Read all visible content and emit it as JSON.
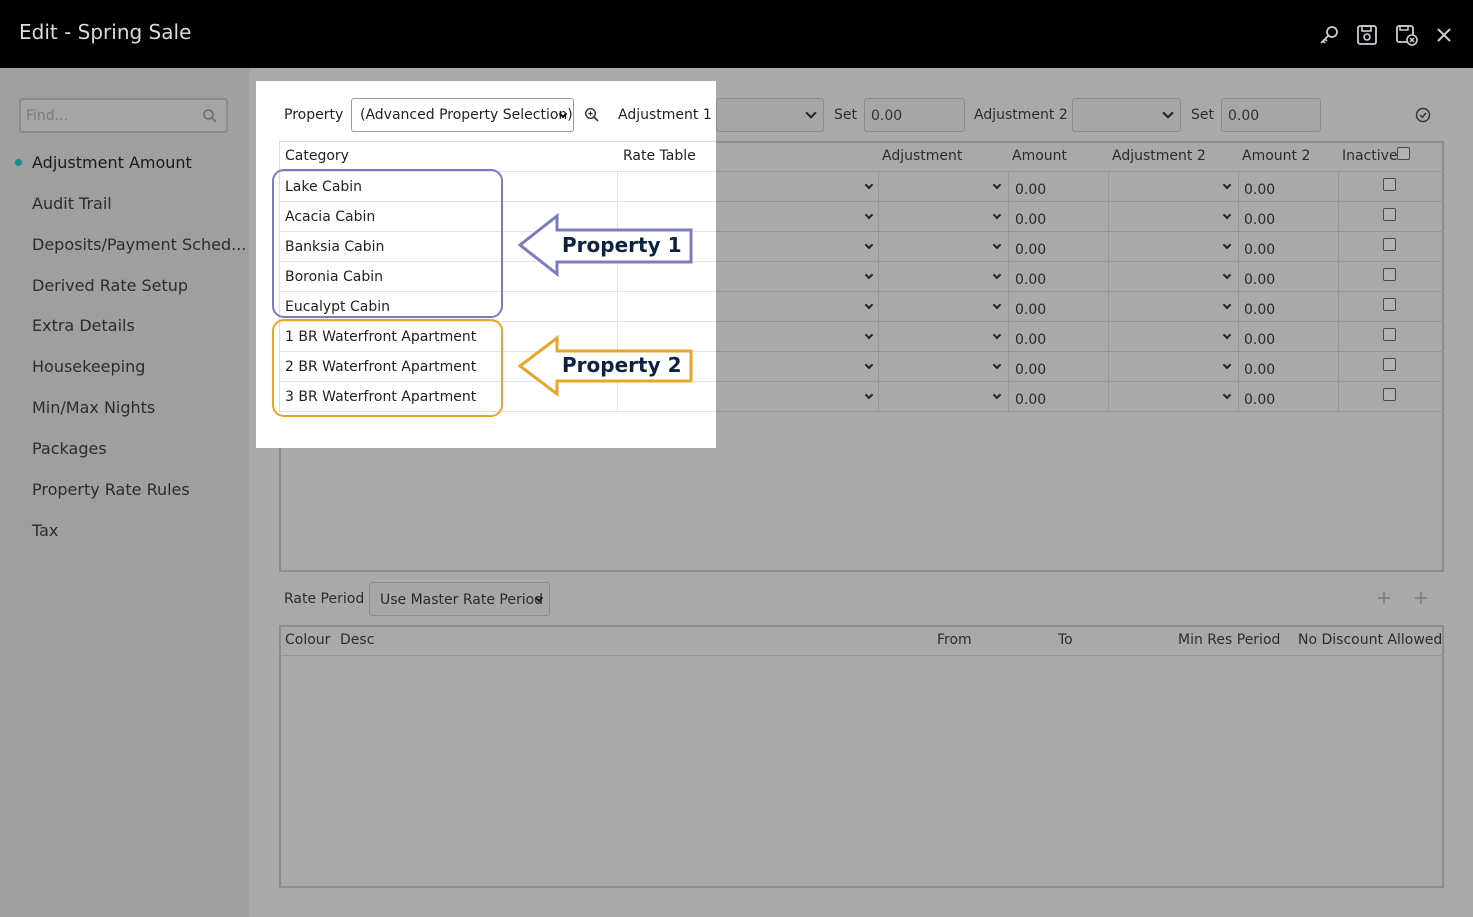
{
  "window": {
    "title": "Edit - Spring Sale",
    "icons": [
      "key-icon",
      "save-icon",
      "save-close-icon",
      "close-icon"
    ]
  },
  "sidebar": {
    "find_placeholder": "Find...",
    "items": [
      {
        "label": "Adjustment Amount",
        "active": true
      },
      {
        "label": "Audit Trail"
      },
      {
        "label": "Deposits/Payment Sched..."
      },
      {
        "label": "Derived Rate Setup"
      },
      {
        "label": "Extra Details"
      },
      {
        "label": "Housekeeping"
      },
      {
        "label": "Min/Max Nights"
      },
      {
        "label": "Packages"
      },
      {
        "label": "Property Rate Rules"
      },
      {
        "label": "Tax"
      }
    ]
  },
  "toolbar": {
    "property_label": "Property",
    "property_value": "(Advanced Property Selection)",
    "adjustment1_label": "Adjustment 1",
    "set1_label": "Set",
    "set1_value": "0.00",
    "adjustment2_label": "Adjustment 2",
    "set2_label": "Set",
    "set2_value": "0.00"
  },
  "grid": {
    "headers": {
      "category": "Category",
      "rate_table": "Rate Table",
      "adjustment": "Adjustment",
      "amount": "Amount",
      "adjustment2": "Adjustment 2",
      "amount2": "Amount 2",
      "inactive": "Inactive"
    },
    "rows": [
      {
        "category": "Lake Cabin",
        "amount": "0.00",
        "amount2": "0.00"
      },
      {
        "category": "Acacia Cabin",
        "amount": "0.00",
        "amount2": "0.00"
      },
      {
        "category": "Banksia Cabin",
        "amount": "0.00",
        "amount2": "0.00"
      },
      {
        "category": "Boronia Cabin",
        "amount": "0.00",
        "amount2": "0.00"
      },
      {
        "category": "Eucalypt Cabin",
        "amount": "0.00",
        "amount2": "0.00"
      },
      {
        "category": "1 BR Waterfront Apartment",
        "amount": "0.00",
        "amount2": "0.00"
      },
      {
        "category": "2 BR Waterfront Apartment",
        "amount": "0.00",
        "amount2": "0.00"
      },
      {
        "category": "3 BR Waterfront Apartment",
        "amount": "0.00",
        "amount2": "0.00"
      }
    ]
  },
  "rate_period": {
    "label": "Rate Period",
    "value": "Use Master Rate Period",
    "headers": {
      "colour": "Colour",
      "desc": "Desc",
      "from": "From",
      "to": "To",
      "min_res_period": "Min Res Period",
      "no_discount": "No Discount Allowed"
    }
  },
  "annotations": {
    "property1": "Property 1",
    "property2": "Property 2",
    "property1_color": "#7b7bbf",
    "property2_color": "#e8a628"
  }
}
